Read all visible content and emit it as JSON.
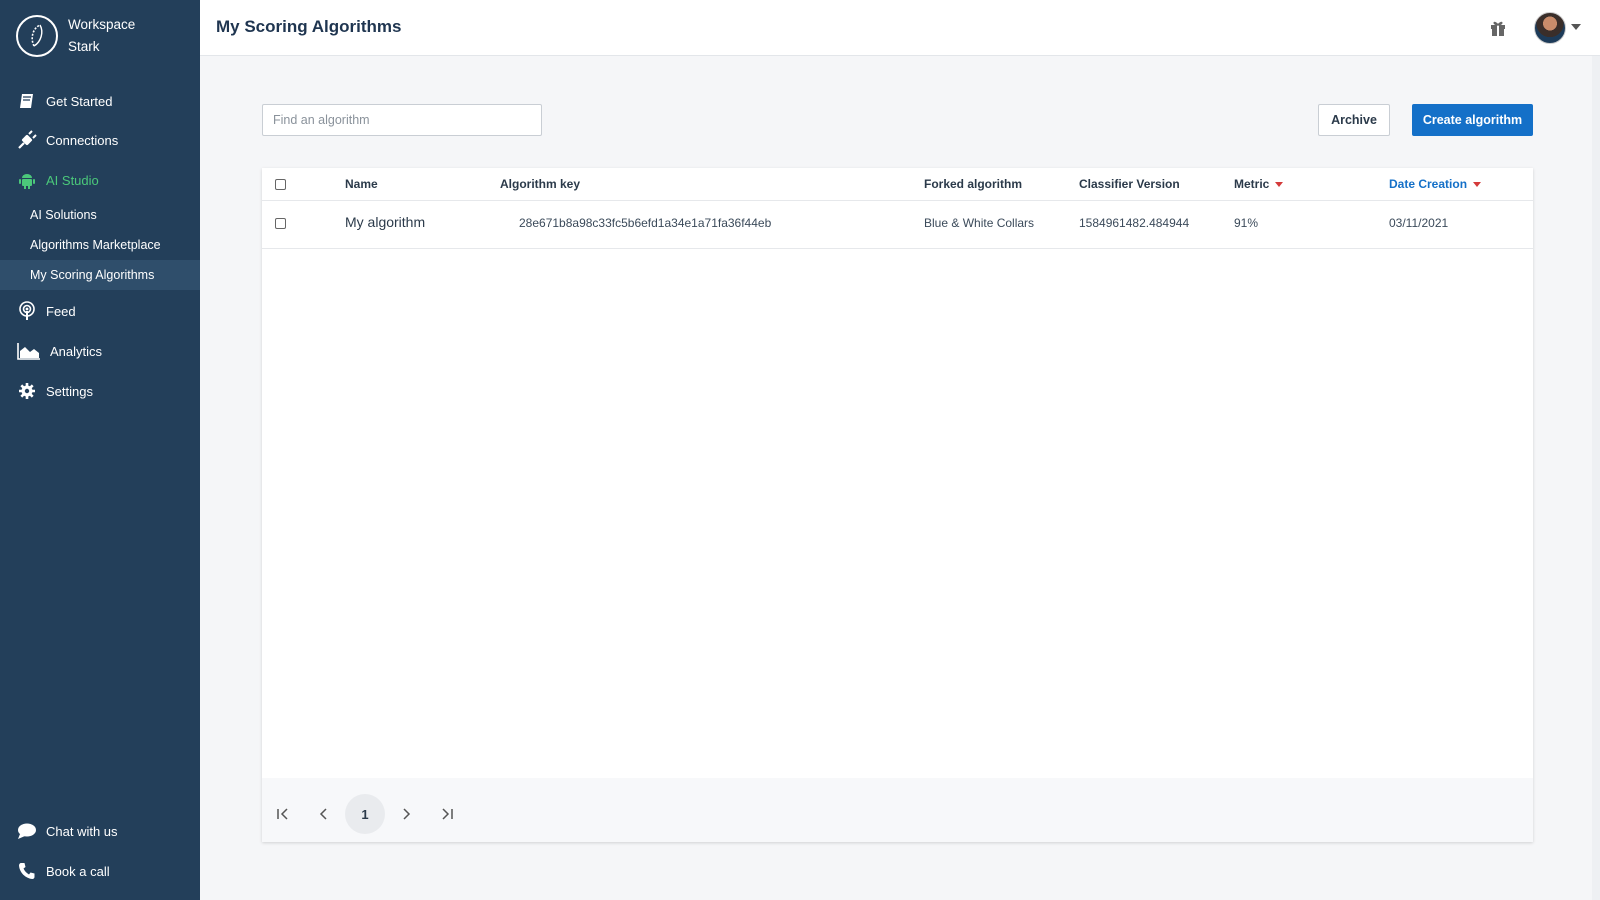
{
  "workspace": {
    "line1": "Workspace",
    "line2": "Stark"
  },
  "sidebar": {
    "items": [
      {
        "label": "Get Started",
        "icon": "book-icon"
      },
      {
        "label": "Connections",
        "icon": "plug-icon"
      },
      {
        "label": "AI Studio",
        "icon": "android-icon"
      },
      {
        "label": "Feed",
        "icon": "podcast-icon"
      },
      {
        "label": "Analytics",
        "icon": "area-chart-icon"
      },
      {
        "label": "Settings",
        "icon": "gear-icon"
      }
    ],
    "sub_items": [
      {
        "label": "AI Solutions"
      },
      {
        "label": "Algorithms Marketplace"
      },
      {
        "label": "My Scoring Algorithms"
      }
    ],
    "bottom": [
      {
        "label": "Chat with us",
        "icon": "chat-icon"
      },
      {
        "label": "Book a call",
        "icon": "phone-icon"
      }
    ]
  },
  "header": {
    "title": "My Scoring Algorithms"
  },
  "toolbar": {
    "search_placeholder": "Find an algorithm",
    "archive_label": "Archive",
    "create_label": "Create algorithm"
  },
  "table": {
    "columns": [
      "Name",
      "Algorithm key",
      "Forked algorithm",
      "Classifier Version",
      "Metric",
      "Date Creation"
    ],
    "rows": [
      {
        "name": "My algorithm",
        "key": "28e671b8a98c33fc5b6efd1a34e1a71fa36f44eb",
        "forked": "Blue & White Collars",
        "classifier": "1584961482.484944",
        "metric": "91%",
        "date": "03/11/2021"
      }
    ]
  },
  "pagination": {
    "current_page": "1"
  },
  "colors": {
    "sidebar_bg": "#233f5a",
    "accent": "#1470c8",
    "active_green": "#4bc87a",
    "sort_red": "#d43a3a"
  }
}
